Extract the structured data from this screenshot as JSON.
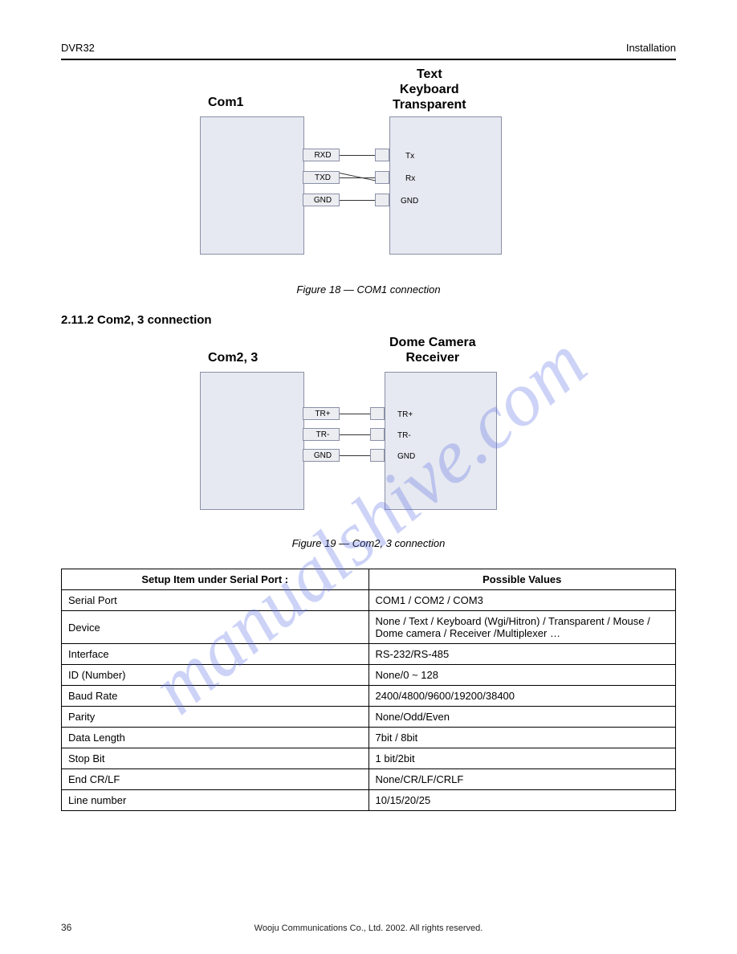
{
  "header": {
    "left": "DVR32",
    "right": "Installation"
  },
  "watermark": "manualshive.com",
  "diag1": {
    "leftTitle": "Com1",
    "rightTitle": "Text\nKeyboard\nTransparent",
    "pinsLeft": [
      "RXD",
      "TXD",
      "GND"
    ],
    "pinsRight": [
      "Tx",
      "Rx",
      "GND"
    ],
    "caption": "Figure 18  — COM1 connection"
  },
  "section2": "2.11.2  Com2, 3 connection",
  "diag2": {
    "leftTitle": "Com2, 3",
    "rightTitle": "Dome Camera\nReceiver",
    "pinsLeft": [
      "TR+",
      "TR-",
      "GND"
    ],
    "pinsRight": [
      "TR+",
      "TR-",
      "GND"
    ],
    "caption": "Figure 19 — Com2, 3 connection"
  },
  "table": {
    "header": [
      "Setup Item under Serial Port :",
      "Possible Values"
    ],
    "rows": [
      [
        "Serial Port",
        "COM1  / COM2 / COM3"
      ],
      [
        "Device",
        "None / Text / Keyboard (Wgi/Hitron)  / Transparent / Mouse / Dome camera / Receiver /Multiplexer …"
      ],
      [
        "Interface",
        "RS-232/RS-485"
      ],
      [
        "ID (Number)",
        "None/0 ~ 128"
      ],
      [
        "Baud Rate",
        "2400/4800/9600/19200/38400"
      ],
      [
        "Parity",
        "None/Odd/Even"
      ],
      [
        "Data Length",
        "7bit / 8bit"
      ],
      [
        "Stop Bit",
        "1 bit/2bit"
      ],
      [
        "End CR/LF",
        "None/CR/LF/CRLF"
      ],
      [
        "Line number",
        "10/15/20/25"
      ]
    ]
  },
  "footer": {
    "pageLeft": "36",
    "copyright": "Wooju Communications Co., Ltd. 2002. All rights reserved."
  }
}
